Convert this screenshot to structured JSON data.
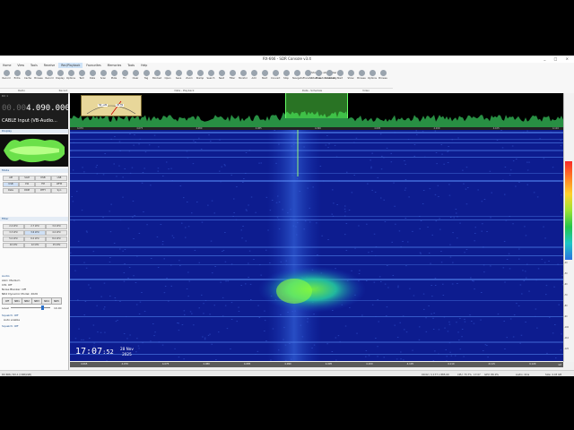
{
  "window": {
    "title": "RX-666 - SDR Console v3.4",
    "controls": "_ □ ×"
  },
  "menu": [
    "Home",
    "View",
    "Tools",
    "Receive",
    "Rec/Playback",
    "Favourites",
    "Memories",
    "Tools",
    "Help"
  ],
  "ribbon": {
    "buttons": [
      "Record",
      "Extra",
      "Cache",
      "Browse",
      "Record",
      "Display",
      "Options",
      "Text",
      "Data",
      "Scan",
      "Mute",
      "Fix",
      "Clear",
      "Tag",
      "Blocked",
      "Open",
      "Save",
      "Zoom",
      "Stamp",
      "Search",
      "Next",
      "Filter",
      "Monitor",
      "Add",
      "Start",
      "Convert",
      "Stop",
      "Navigator",
      "Transfer",
      "Mute",
      "Schedule",
      "Start",
      "Show",
      "Browse",
      "Options",
      "Browse"
    ],
    "groups": [
      "Radio",
      "Record",
      "Data - Playback",
      "Data - Schedule",
      "Video"
    ],
    "schedule_opts": [
      "Show as status bar",
      "Start automatically"
    ]
  },
  "radio": {
    "label": "RX 1",
    "frequency_prefix": "00.00",
    "frequency": "4.090.000",
    "source": "CABLE Input (VB-Audio..."
  },
  "meter": {
    "readings": [
      "S9 +20",
      "20 Hz"
    ]
  },
  "spectrum": {
    "axis_ticks": [
      "4.070",
      "4.075",
      "4.080",
      "4.085",
      "4.090",
      "4.095",
      "4.100",
      "4.105",
      "4.110"
    ],
    "right_labels": [
      "-40",
      "-50",
      "-60",
      "-70",
      "-80",
      "-90",
      "-100",
      "-110",
      "-120"
    ]
  },
  "left_panel": {
    "sections": {
      "display": "Display",
      "mode": "Mode",
      "filter": "Filter"
    },
    "mode_buttons": [
      "AM",
      "SAM",
      "DSB",
      "LSB",
      "USB",
      "CW",
      "FM",
      "WFM",
      "Data",
      "DRM",
      "RTTY",
      "Syn"
    ],
    "filter_cells": [
      "2.4 kHz",
      "2.7 kHz",
      "3.0 kHz",
      "3.3 kHz",
      "3.6 kHz",
      "4.0 kHz",
      "5.0 kHz",
      "6.0 kHz",
      "8.0 kHz",
      "10 kHz",
      "12 kHz",
      "15 kHz"
    ],
    "info_lines": [
      "Audio",
      "AGC: Medium",
      "CW: Off",
      "Noise Blanker: Off",
      "NR2 Dynamic Model: 2026"
    ],
    "agc_buttons": [
      "Off",
      "NB1",
      "NB2",
      "NB3",
      "NR4",
      "NR5"
    ],
    "level_label": "Level",
    "level_value": "10.00",
    "squelch_label": "Squelch: Off",
    "squelch_value": "Auto enable",
    "squelch_footer": "Squelch: Off"
  },
  "clock": {
    "time_hm": "17:07",
    "time_s": "52",
    "day_month": "28 Nov",
    "year": "2025"
  },
  "bottom_axis": {
    "ticks": [
      "4.065",
      "4.070",
      "4.075",
      "4.080",
      "4.085",
      "4.090",
      "4.095",
      "4.100",
      "4.105",
      "4.110",
      "4.115",
      "4.120"
    ],
    "zoom": "x2"
  },
  "status": {
    "left": "RX 666 / RX-1 (USB/LSB)",
    "coords": "00:02 / 1 177 x 885.00",
    "cpu": "CPU: 73.7%",
    "time": "17:07",
    "gpu": "GPU: 86.9%",
    "audio": "Audio: 4ms",
    "size": "Size: 4.03 GB"
  }
}
